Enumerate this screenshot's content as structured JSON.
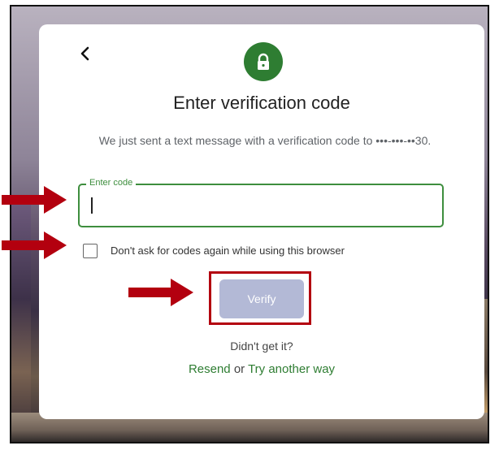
{
  "dialog": {
    "title": "Enter verification code",
    "message": "We just sent a text message with a verification code to •••-•••-••30.",
    "code_field": {
      "label": "Enter code",
      "value": ""
    },
    "remember_checkbox": {
      "label": "Don't ask for codes again while using this browser",
      "checked": false
    },
    "verify_button": {
      "label": "Verify",
      "enabled": false
    },
    "didnt_get_it": "Didn't get it?",
    "resend_link": "Resend",
    "or_text": "or",
    "try_another_way_link": "Try another way"
  },
  "icons": {
    "back": "chevron-left-icon",
    "lock": "lock-icon",
    "arrows": "right-arrow-icon"
  },
  "colors": {
    "accent_green": "#2e7d32",
    "field_border": "#3e8e3e",
    "verify_disabled_bg": "#b3b9d6",
    "annotation_red": "#b3000f"
  }
}
